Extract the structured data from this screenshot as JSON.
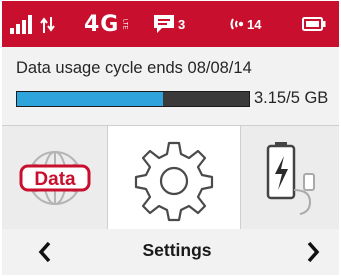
{
  "status_bar": {
    "network_type": "4G",
    "network_sub": "LTE",
    "message_count": "3",
    "connected_devices": "14",
    "colors": {
      "background": "#c8102e",
      "foreground": "#ffffff"
    },
    "icons": [
      "signal-strength-icon",
      "data-transfer-icon",
      "message-icon",
      "wifi-devices-icon",
      "battery-icon"
    ]
  },
  "usage": {
    "label": "Data usage cycle ends 08/08/14",
    "amount": "3.15/5 GB",
    "used_fraction": 0.63,
    "colors": {
      "fill": "#2fa3dc",
      "track": "#3a3a3a"
    }
  },
  "carousel": {
    "items": [
      {
        "name": "data-globe-icon",
        "text": "Data"
      },
      {
        "name": "settings-gear-icon"
      },
      {
        "name": "battery-charging-icon"
      }
    ],
    "selected": "settings-gear-icon"
  },
  "nav": {
    "title": "Settings",
    "prev_glyph": "❮",
    "next_glyph": "❯"
  }
}
